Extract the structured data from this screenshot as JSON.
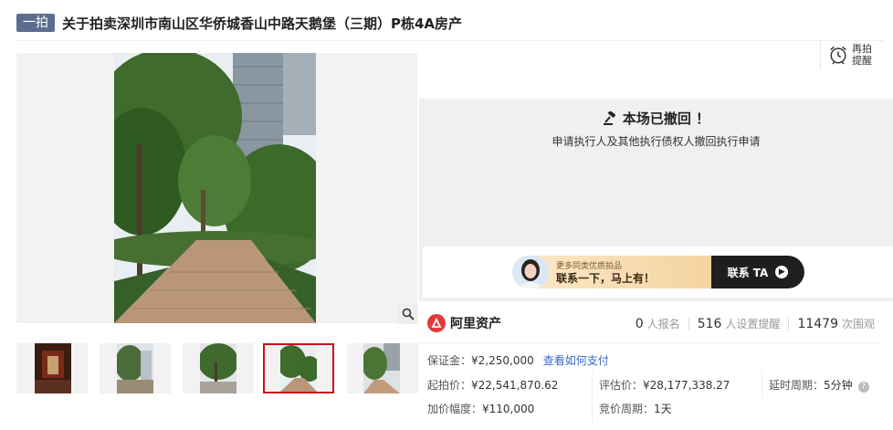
{
  "title": {
    "badge": "一拍",
    "text": "关于拍卖深圳市南山区华侨城香山中路天鹅堡（三期）P栋4A房产"
  },
  "remind": {
    "label": "再拍提醒",
    "icon": "alarm-clock-icon"
  },
  "withdrawn": {
    "title": "本场已撤回 ！",
    "desc": "申请执行人及其他执行债权人撤回执行申请",
    "icon": "gavel-icon"
  },
  "contact": {
    "small_text": "更多同类优质拍品",
    "big_text": "联系一下，马上有！",
    "button": "联系 TA"
  },
  "platform": {
    "name": "阿里资产"
  },
  "stats": {
    "signups": "0",
    "signups_label": "人报名",
    "reminders": "516",
    "reminders_label": "人设置提醒",
    "views": "11479",
    "views_label": "次围观"
  },
  "info": {
    "deposit_label": "保证金：",
    "deposit_value": "¥2,250,000",
    "deposit_link": "查看如何支付",
    "start_price_label": "起拍价：",
    "start_price_value": "¥22,541,870.62",
    "appraisal_label": "评估价：",
    "appraisal_value": "¥28,177,338.27",
    "delay_label": "延时周期：",
    "delay_value": "5分钟",
    "increment_label": "加价幅度：",
    "increment_value": "¥110,000",
    "bid_period_label": "竞价周期：",
    "bid_period_value": "1天"
  },
  "thumbnails": {
    "count": 5,
    "active_index": 3
  },
  "colors": {
    "badge": "#5c6e8f",
    "accent_red": "#c8101b",
    "link": "#3366cc"
  }
}
